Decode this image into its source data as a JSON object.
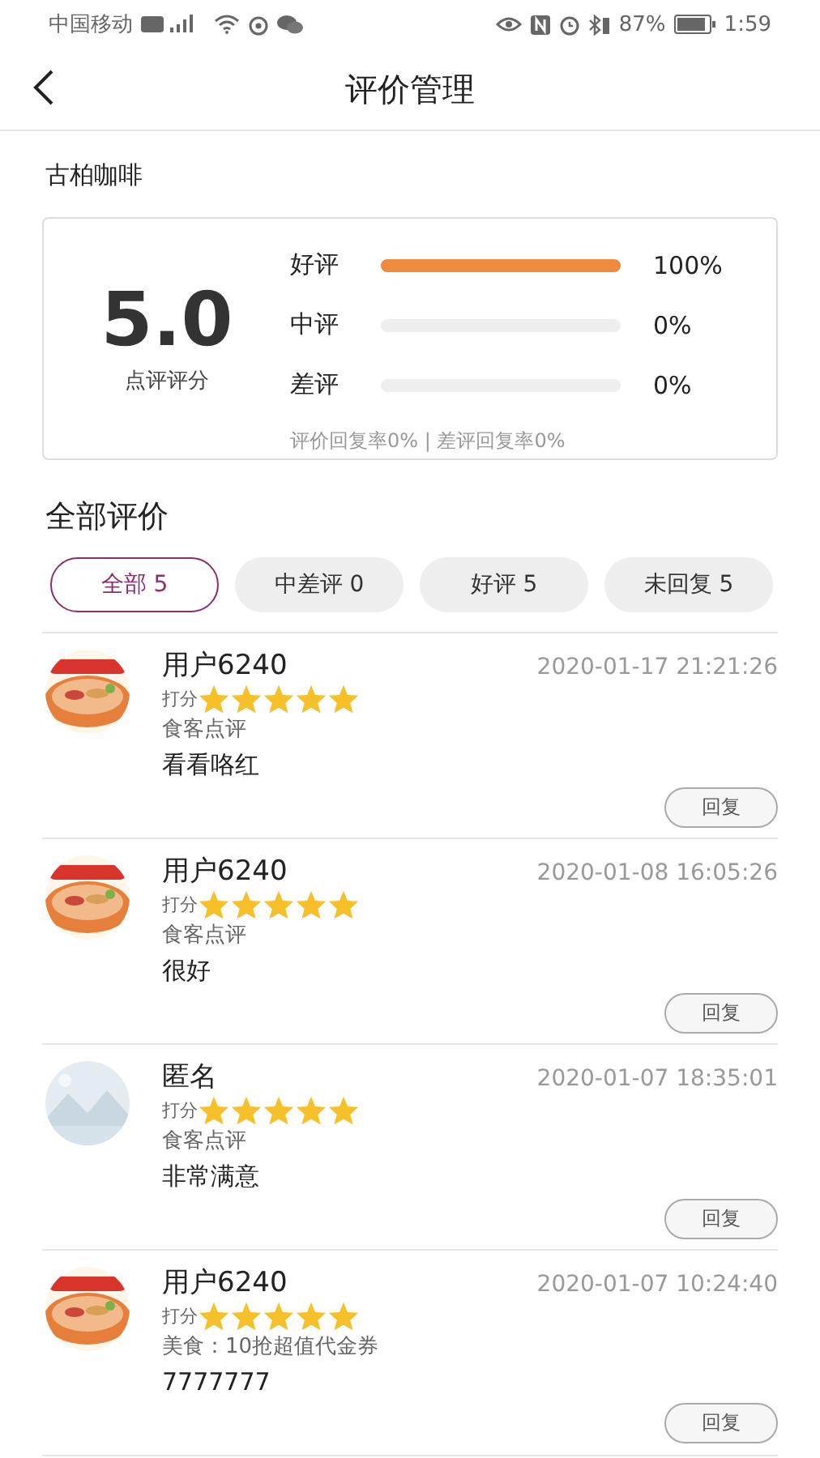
{
  "status_bar": {
    "carrier": "中国移动",
    "battery": "87%",
    "time": "1:59"
  },
  "header": {
    "title": "评价管理"
  },
  "shop_name": "古柏咖啡",
  "summary": {
    "score": "5.0",
    "score_label": "点评评分",
    "bars": [
      {
        "label": "好评",
        "level": 1.0,
        "percent": "100%"
      },
      {
        "label": "中评",
        "level": 0,
        "percent": "0%"
      },
      {
        "label": "差评",
        "level": 0,
        "percent": "0%"
      }
    ],
    "reply_rates": "评价回复率0% | 差评回复率0%"
  },
  "section_title": "全部评价",
  "filters": [
    {
      "label": "全部 5",
      "selected": true
    },
    {
      "label": "中差评 0",
      "selected": false
    },
    {
      "label": "好评 5",
      "selected": false
    },
    {
      "label": "未回复 5",
      "selected": false
    }
  ],
  "reviews": [
    {
      "user": "用户6240",
      "time": "2020-01-17 21:21:26",
      "rating_label": "打分",
      "stars": 5,
      "source": "食客点评",
      "text": "看看咯红",
      "reply_button": "回复"
    },
    {
      "user": "用户6240",
      "time": "2020-01-08 16:05:26",
      "rating_label": "打分",
      "stars": 5,
      "source": "食客点评",
      "text": "很好",
      "reply_button": "回复"
    },
    {
      "user": "匿名",
      "time": "2020-01-07 18:35:01",
      "rating_label": "打分",
      "stars": 5,
      "source": "食客点评",
      "text": "非常满意",
      "reply_button": "回复"
    },
    {
      "user": "用户6240",
      "time": "2020-01-07 10:24:40",
      "rating_label": "打分",
      "stars": 5,
      "source": "美食：10抢超值代金券",
      "text": "7777777",
      "reply_button": "回复"
    }
  ]
}
